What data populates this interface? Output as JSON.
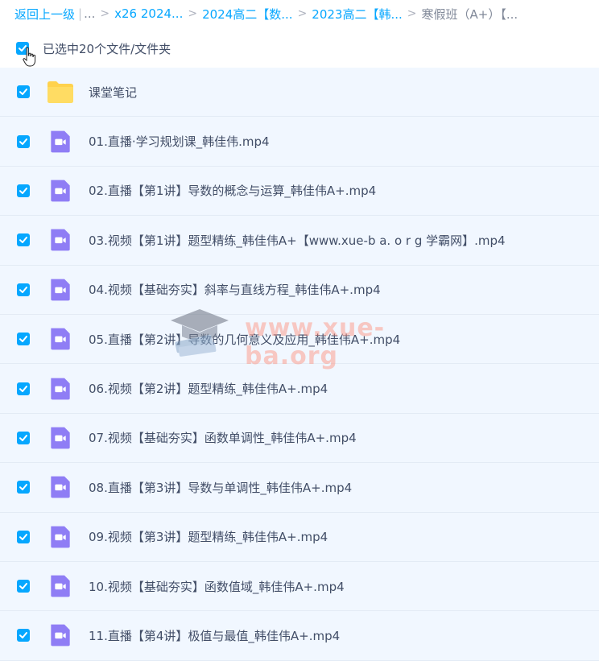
{
  "breadcrumb": {
    "back_label": "返回上一级",
    "ellipsis": "...",
    "items": [
      "x26 2024...",
      "2024高二【数...",
      "2023高二【韩..."
    ],
    "current": "寒假班（A+）【..."
  },
  "selection": {
    "label": "已选中20个文件/文件夹",
    "checked": true
  },
  "files": [
    {
      "type": "folder",
      "name": "课堂笔记"
    },
    {
      "type": "video",
      "name": "01.直播·学习规划课_韩佳伟.mp4"
    },
    {
      "type": "video",
      "name": "02.直播【第1讲】导数的概念与运算_韩佳伟A+.mp4"
    },
    {
      "type": "video",
      "name": "03.视频【第1讲】题型精练_韩佳伟A+【www.xue-b a. o r g 学霸网】.mp4"
    },
    {
      "type": "video",
      "name": "04.视频【基础夯实】斜率与直线方程_韩佳伟A+.mp4"
    },
    {
      "type": "video",
      "name": "05.直播【第2讲】导数的几何意义及应用_韩佳伟A+.mp4"
    },
    {
      "type": "video",
      "name": "06.视频【第2讲】题型精练_韩佳伟A+.mp4"
    },
    {
      "type": "video",
      "name": "07.视频【基础夯实】函数单调性_韩佳伟A+.mp4"
    },
    {
      "type": "video",
      "name": "08.直播【第3讲】导数与单调性_韩佳伟A+.mp4"
    },
    {
      "type": "video",
      "name": "09.视频【第3讲】题型精练_韩佳伟A+.mp4"
    },
    {
      "type": "video",
      "name": "10.视频【基础夯实】函数值域_韩佳伟A+.mp4"
    },
    {
      "type": "video",
      "name": "11.直播【第4讲】极值与最值_韩佳伟A+.mp4"
    }
  ],
  "watermark": {
    "text": "www.xue-ba.org"
  },
  "colors": {
    "accent": "#06a7ff",
    "row_bg": "#f1f7ff",
    "video_icon": "#8f7df5",
    "folder_icon": "#ffd24d"
  }
}
